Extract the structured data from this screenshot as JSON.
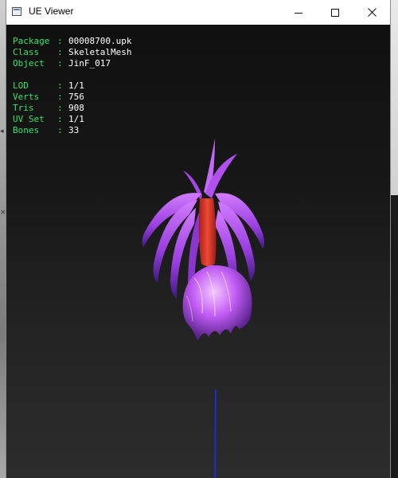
{
  "window": {
    "title": "UE Viewer",
    "controls": {
      "minimize": "minimize",
      "maximize": "maximize",
      "close": "close"
    }
  },
  "info": {
    "package": {
      "key": "Package",
      "value": "00008700.upk"
    },
    "class": {
      "key": "Class",
      "value": "SkeletalMesh"
    },
    "object": {
      "key": "Object",
      "value": "JinF_017"
    },
    "lod": {
      "key": "LOD",
      "value": "1/1"
    },
    "verts": {
      "key": "Verts",
      "value": "756"
    },
    "tris": {
      "key": "Tris",
      "value": "908"
    },
    "uvset": {
      "key": "UV Set",
      "value": "1/1"
    },
    "bones": {
      "key": "Bones",
      "value": "33"
    },
    "separator": ":"
  },
  "colors": {
    "label_green": "#2ee66a",
    "value_white": "#ffffff",
    "mesh_purple": "#b34ff0",
    "mesh_red": "#e03a2a",
    "axis_blue": "#1a2cd6"
  }
}
